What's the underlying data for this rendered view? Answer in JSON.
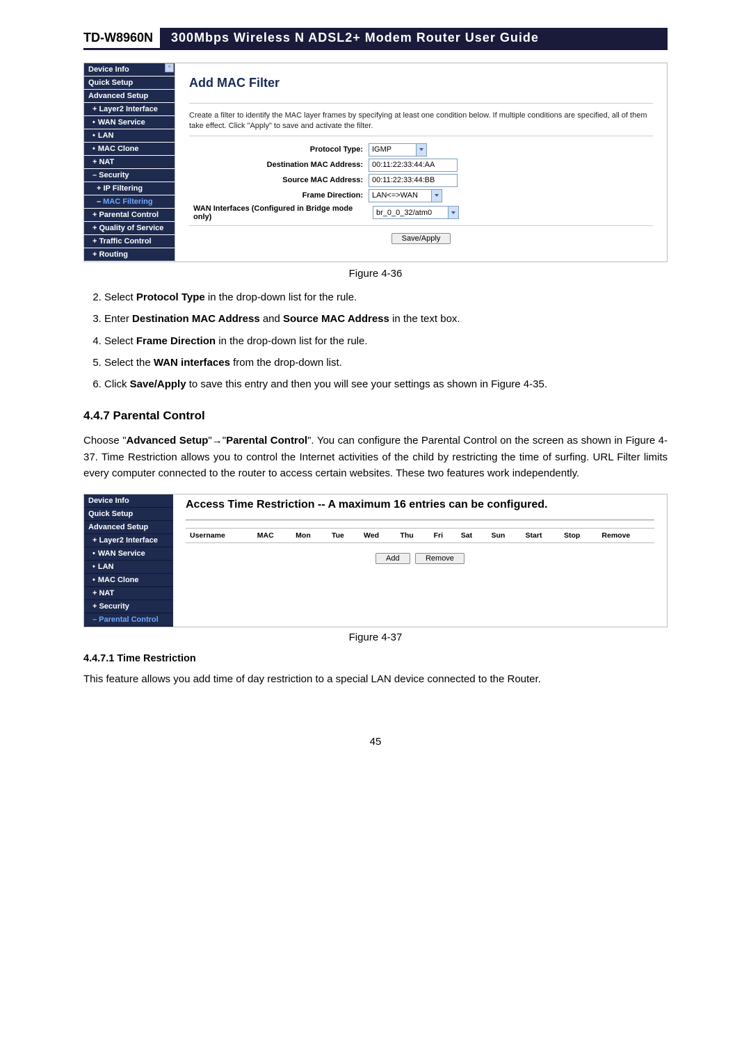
{
  "header": {
    "model": "TD-W8960N",
    "title": "300Mbps  Wireless  N  ADSL2+  Modem  Router  User  Guide"
  },
  "shot1": {
    "nav": [
      {
        "label": "Device Info",
        "cls": ""
      },
      {
        "label": "Quick Setup",
        "cls": ""
      },
      {
        "label": "Advanced Setup",
        "cls": ""
      },
      {
        "label": "Layer2 Interface",
        "cls": "nav-sub",
        "icon": "plus"
      },
      {
        "label": "WAN Service",
        "cls": "nav-sub",
        "icon": "dot"
      },
      {
        "label": "LAN",
        "cls": "nav-sub",
        "icon": "dot"
      },
      {
        "label": "MAC Clone",
        "cls": "nav-sub",
        "icon": "dot"
      },
      {
        "label": "NAT",
        "cls": "nav-sub",
        "icon": "plus"
      },
      {
        "label": "Security",
        "cls": "nav-sub",
        "icon": "minus"
      },
      {
        "label": "IP Filtering",
        "cls": "nav-sub2",
        "icon": "plus"
      },
      {
        "label": "MAC Filtering",
        "cls": "nav-sub2 nav-active",
        "icon": "minus"
      },
      {
        "label": "Parental Control",
        "cls": "nav-sub",
        "icon": "plus"
      },
      {
        "label": "Quality of Service",
        "cls": "nav-sub",
        "icon": "plus"
      },
      {
        "label": "Traffic Control",
        "cls": "nav-sub",
        "icon": "plus"
      },
      {
        "label": "Routing",
        "cls": "nav-sub",
        "icon": "plus"
      }
    ],
    "title": "Add MAC Filter",
    "desc": "Create a filter to identify the MAC layer frames by specifying at least one condition below. If multiple conditions are specified, all of them take effect. Click \"Apply\" to save and activate the filter.",
    "fields": {
      "protocol_label": "Protocol Type:",
      "protocol_value": "IGMP",
      "dest_label": "Destination MAC Address:",
      "dest_value": "00:11:22:33:44:AA",
      "src_label": "Source MAC Address:",
      "src_value": "00:11:22:33:44:BB",
      "frame_label": "Frame Direction:",
      "frame_value": "LAN<=>WAN",
      "wan_label": "WAN Interfaces (Configured in Bridge mode only)",
      "wan_value": "br_0_0_32/atm0"
    },
    "save_btn": "Save/Apply",
    "caption": "Figure 4-36"
  },
  "steps": {
    "s2a": "Select ",
    "s2b": "Protocol Type",
    "s2c": " in the drop-down list for the rule.",
    "s3a": "Enter ",
    "s3b": "Destination MAC Address",
    "s3c": " and ",
    "s3d": "Source MAC Address",
    "s3e": " in the text box.",
    "s4a": "Select ",
    "s4b": "Frame Direction",
    "s4c": " in the drop-down list for the rule.",
    "s5a": "Select the ",
    "s5b": "WAN interfaces",
    "s5c": " from the drop-down list.",
    "s6a": "Click ",
    "s6b": "Save/Apply",
    "s6c": " to save this entry and then you will see your settings as shown in Figure 4-35."
  },
  "section": {
    "num_title": "4.4.7  Parental Control",
    "p1a": "Choose \"",
    "p1b": "Advanced Setup",
    "p1c": "\"",
    "arrow": "→",
    "p1d": "\"",
    "p1e": "Parental Control",
    "p1f": "\". You can configure the Parental Control on the screen as shown in Figure 4-37. Time Restriction allows you to control the Internet activities of the child by restricting the time of surfing. URL Filter limits every computer connected to the router to access certain websites. These two features work independently."
  },
  "shot2": {
    "nav": [
      {
        "label": "Device Info",
        "cls": ""
      },
      {
        "label": "Quick Setup",
        "cls": ""
      },
      {
        "label": "Advanced Setup",
        "cls": ""
      },
      {
        "label": "Layer2 Interface",
        "cls": "sub",
        "icon": "plus"
      },
      {
        "label": "WAN Service",
        "cls": "sub",
        "icon": "dot"
      },
      {
        "label": "LAN",
        "cls": "sub",
        "icon": "dot"
      },
      {
        "label": "MAC Clone",
        "cls": "sub",
        "icon": "dot"
      },
      {
        "label": "NAT",
        "cls": "sub",
        "icon": "plus"
      },
      {
        "label": "Security",
        "cls": "sub",
        "icon": "plus"
      },
      {
        "label": "Parental Control",
        "cls": "sub active",
        "icon": "minus"
      }
    ],
    "title": "Access Time Restriction -- A maximum 16 entries can be configured.",
    "cols": [
      "Username",
      "MAC",
      "Mon",
      "Tue",
      "Wed",
      "Thu",
      "Fri",
      "Sat",
      "Sun",
      "Start",
      "Stop",
      "Remove"
    ],
    "add_btn": "Add",
    "remove_btn": "Remove",
    "caption": "Figure 4-37"
  },
  "sub447": {
    "title": "4.4.7.1  Time Restriction",
    "para": "This feature allows you add time of day restriction to a special LAN device connected to the Router."
  },
  "pagenum": "45"
}
